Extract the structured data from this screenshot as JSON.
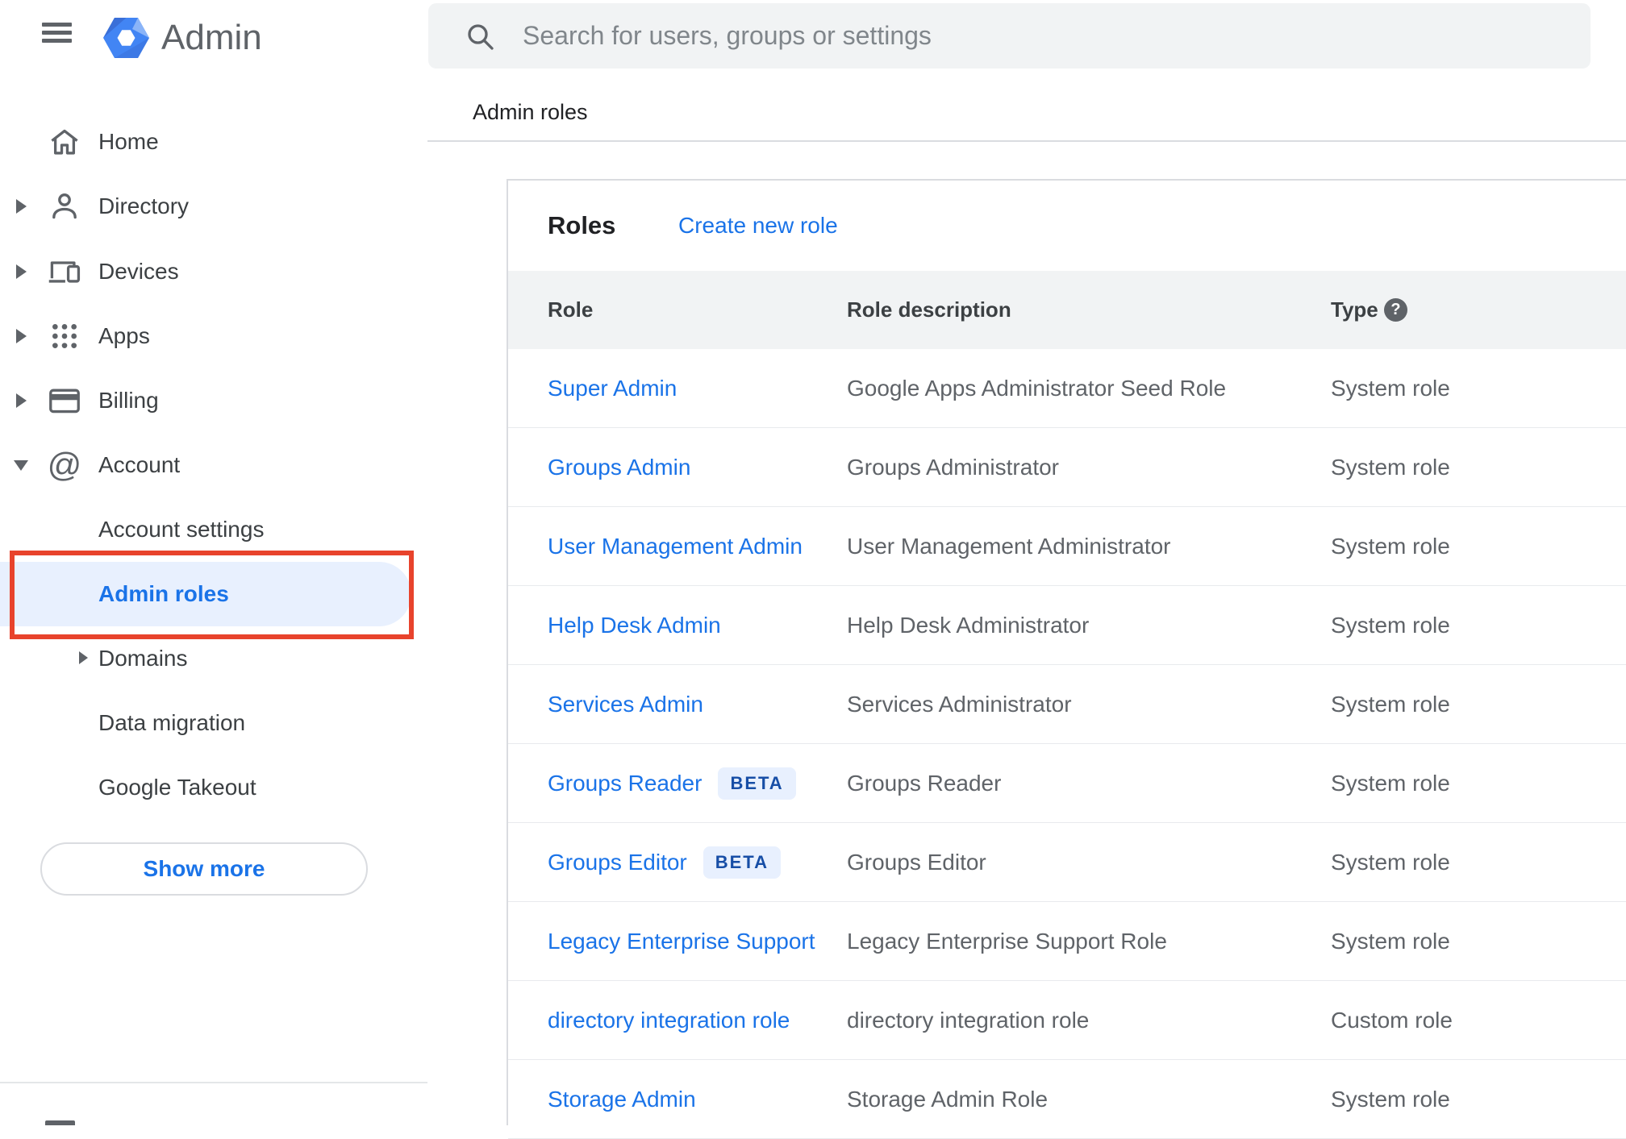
{
  "app": {
    "title": "Admin"
  },
  "search": {
    "placeholder": "Search for users, groups or settings"
  },
  "breadcrumb": "Admin roles",
  "sidebar": {
    "items": [
      {
        "label": "Home",
        "icon": "home-icon",
        "expandable": false
      },
      {
        "label": "Directory",
        "icon": "person-icon",
        "expandable": true,
        "state": "collapsed"
      },
      {
        "label": "Devices",
        "icon": "devices-icon",
        "expandable": true,
        "state": "collapsed"
      },
      {
        "label": "Apps",
        "icon": "apps-grid-icon",
        "expandable": true,
        "state": "collapsed"
      },
      {
        "label": "Billing",
        "icon": "billing-card-icon",
        "expandable": true,
        "state": "collapsed"
      },
      {
        "label": "Account",
        "icon": "at-sign-icon",
        "expandable": true,
        "state": "expanded"
      }
    ],
    "account_children": [
      {
        "label": "Account settings",
        "active": false
      },
      {
        "label": "Admin roles",
        "active": true
      },
      {
        "label": "Domains",
        "active": false,
        "expandable": true
      },
      {
        "label": "Data migration",
        "active": false
      },
      {
        "label": "Google Takeout",
        "active": false
      }
    ],
    "show_more_label": "Show more"
  },
  "roles_panel": {
    "title": "Roles",
    "create_link": "Create new role",
    "columns": {
      "role": "Role",
      "description": "Role description",
      "type": "Type"
    },
    "help_glyph": "?",
    "beta_label": "BETA",
    "rows": [
      {
        "role": "Super Admin",
        "beta": false,
        "description": "Google Apps Administrator Seed Role",
        "type": "System role"
      },
      {
        "role": "Groups Admin",
        "beta": false,
        "description": "Groups Administrator",
        "type": "System role"
      },
      {
        "role": "User Management Admin",
        "beta": false,
        "description": "User Management Administrator",
        "type": "System role"
      },
      {
        "role": "Help Desk Admin",
        "beta": false,
        "description": "Help Desk Administrator",
        "type": "System role"
      },
      {
        "role": "Services Admin",
        "beta": false,
        "description": "Services Administrator",
        "type": "System role"
      },
      {
        "role": "Groups Reader",
        "beta": true,
        "description": "Groups Reader",
        "type": "System role"
      },
      {
        "role": "Groups Editor",
        "beta": true,
        "description": "Groups Editor",
        "type": "System role"
      },
      {
        "role": "Legacy Enterprise Support",
        "beta": false,
        "description": "Legacy Enterprise Support Role",
        "type": "System role"
      },
      {
        "role": "directory integration role",
        "beta": false,
        "description": "directory integration role",
        "type": "Custom role"
      },
      {
        "role": "Storage Admin",
        "beta": false,
        "description": "Storage Admin Role",
        "type": "System role"
      }
    ]
  },
  "colors": {
    "accent_blue": "#1a73e8",
    "highlight_pill": "#e8f0fe",
    "annotation_red": "#e8432c",
    "search_bg": "#f1f3f4",
    "table_header_bg": "#f1f3f4",
    "icon_gray": "#5f6368",
    "text_dark": "#202124",
    "text_gray": "#5f6368",
    "divider": "#dadce0",
    "beta_text": "#174ea6"
  }
}
